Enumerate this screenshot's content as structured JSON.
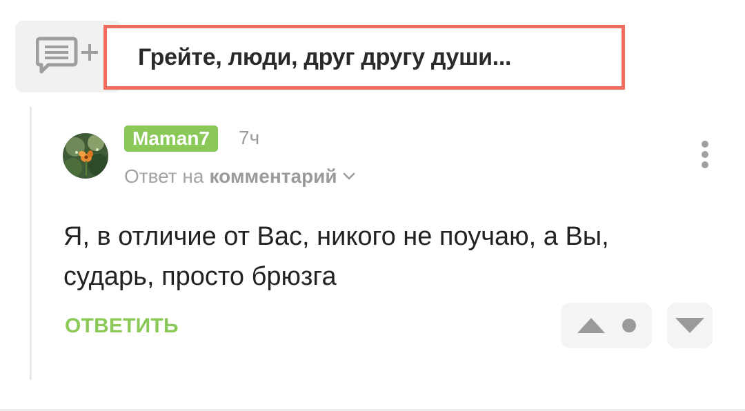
{
  "post": {
    "title": "Грейте, люди, друг другу души..."
  },
  "comment": {
    "author": "Maman7",
    "time": "7ч",
    "reply_prefix": "Ответ на",
    "reply_target": "комментарий",
    "text": "Я, в отличие от Вас, никого не поучаю, а Вы, сударь, просто брюзга",
    "reply_label": "ОТВЕТИТЬ"
  },
  "icons": {
    "add_comment": "comment-add-icon",
    "more": "more-vertical-icon",
    "chevron": "chevron-down-icon",
    "vote_up": "triangle-up-icon",
    "vote_down": "triangle-down-icon",
    "rating": "dot-icon"
  },
  "colors": {
    "accent_green": "#8ac858",
    "highlight_red": "#f16b5e",
    "muted_text": "#9a9a9a",
    "panel_gray": "#f4f4f4"
  }
}
